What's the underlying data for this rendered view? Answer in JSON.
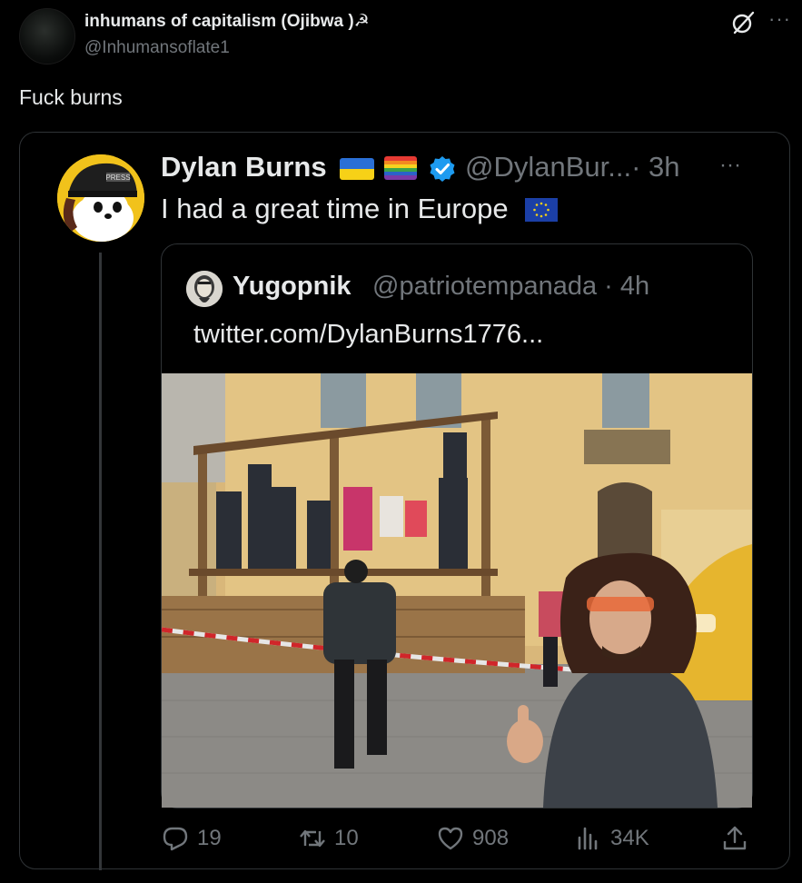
{
  "post": {
    "author_name": "inhumans of capitalism (Ojibwa )☭",
    "author_handle": "@Inhumansoflate1",
    "text": "Fuck burns",
    "more_label": "···"
  },
  "quoted": {
    "author_name": "Dylan Burns",
    "author_handle": "@DylanBur...",
    "time": "· 3h",
    "text": "I had a great time in Europe",
    "more_label": "···"
  },
  "inner_quoted": {
    "author_name": "Yugopnik",
    "author_handle": "@patriotempanada · 4h",
    "link_text": "twitter.com/DylanBurns1776..."
  },
  "actions": {
    "replies": "19",
    "reposts": "10",
    "likes": "908",
    "views": "34K"
  },
  "icons": [
    "grok-icon",
    "more-icon",
    "verified-icon",
    "reply-icon",
    "repost-icon",
    "like-icon",
    "views-icon",
    "share-icon"
  ],
  "colors": {
    "background": "#000000",
    "text_primary": "#e7e9ea",
    "text_secondary": "#71767b",
    "border": "#2f3336",
    "verified_blue": "#1d9bf0"
  }
}
